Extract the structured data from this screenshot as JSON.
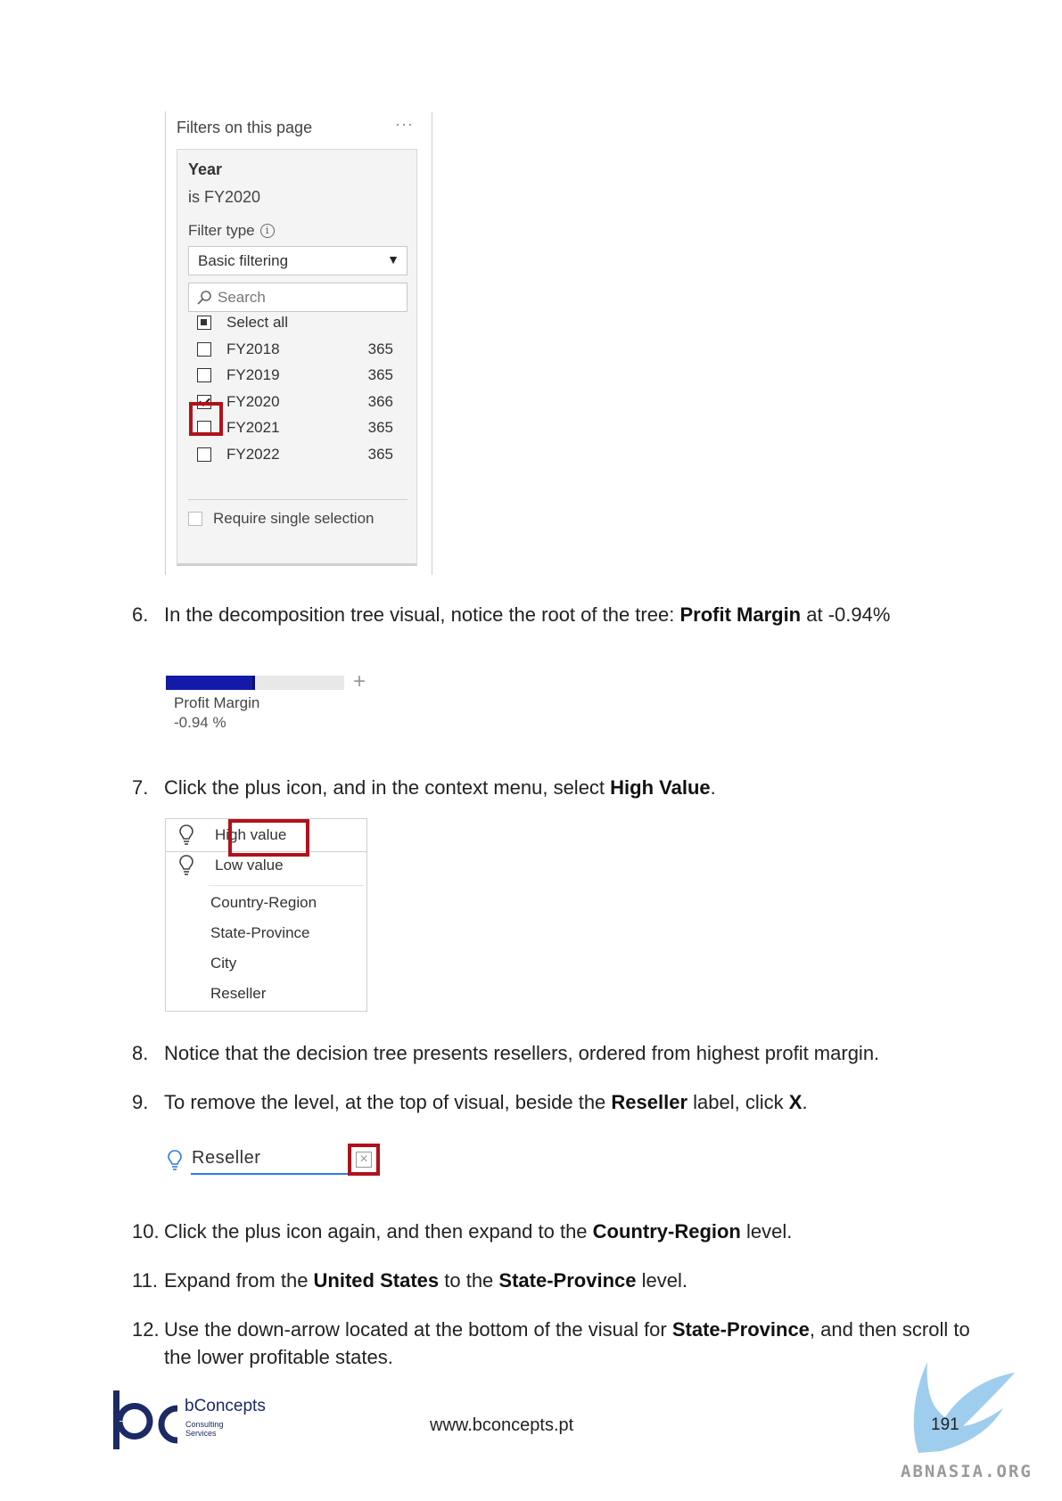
{
  "filter_pane": {
    "header": "Filters on this page",
    "more": "···",
    "card_title": "Year",
    "card_subtitle": "is FY2020",
    "filter_type_label": "Filter type",
    "info_symbol": "i",
    "dropdown_value": "Basic filtering",
    "search_placeholder": "Search",
    "select_all": "Select all",
    "items": [
      {
        "label": "FY2018",
        "count": "365",
        "checked": false
      },
      {
        "label": "FY2019",
        "count": "365",
        "checked": false
      },
      {
        "label": "FY2020",
        "count": "366",
        "checked": true
      },
      {
        "label": "FY2021",
        "count": "365",
        "checked": false
      },
      {
        "label": "FY2022",
        "count": "365",
        "checked": false
      }
    ],
    "require_single": "Require single selection",
    "highlight_color": "#b0121b"
  },
  "steps": [
    {
      "num": "6.",
      "parts": [
        {
          "t": "In the decomposition tree visual, notice the root of the tree: "
        },
        {
          "b": "Profit Margin"
        },
        {
          "t": " at -0.94%"
        }
      ]
    },
    {
      "num": "7.",
      "parts": [
        {
          "t": "Click the plus icon, and in the context menu, select "
        },
        {
          "b": "High Value"
        },
        {
          "t": "."
        }
      ]
    },
    {
      "num": "8.",
      "parts": [
        {
          "t": "Notice that the decision tree presents resellers, ordered from highest profit margin."
        }
      ]
    },
    {
      "num": "9.",
      "parts": [
        {
          "t": "To remove the level, at the top of visual, beside the "
        },
        {
          "b": "Reseller"
        },
        {
          "t": " label, click "
        },
        {
          "b": "X"
        },
        {
          "t": "."
        }
      ]
    },
    {
      "num": "10.",
      "parts": [
        {
          "t": "Click the plus icon again, and then expand to the "
        },
        {
          "b": "Country-Region"
        },
        {
          "t": " level."
        }
      ]
    },
    {
      "num": "11.",
      "parts": [
        {
          "t": "Expand from the "
        },
        {
          "b": "United States"
        },
        {
          "t": " to the "
        },
        {
          "b": "State-Province"
        },
        {
          "t": " level."
        }
      ]
    },
    {
      "num": "12.",
      "parts": [
        {
          "t": "Use the down-arrow located at the bottom of the visual for "
        },
        {
          "b": "State-Province"
        },
        {
          "t": ", and then scroll to the lower profitable states."
        }
      ]
    }
  ],
  "decomp_bar": {
    "name": "Profit Margin",
    "value": "-0.94 %",
    "fill_fraction": 0.5,
    "fill_color": "#141aa8",
    "plus": "+"
  },
  "context_menu": {
    "ai_items": [
      "High value",
      "Low value"
    ],
    "fields": [
      "Country-Region",
      "State-Province",
      "City",
      "Reseller"
    ]
  },
  "reseller": {
    "label": "Reseller",
    "x_symbol": "×",
    "underline_color": "#2b7be5"
  },
  "footer": {
    "brand": "bConcepts",
    "brand_sub1": "Consulting",
    "brand_sub2": "Services",
    "website": "www.bconcepts.pt",
    "page_number": "191",
    "watermark": "ABNASIA.ORG",
    "brand_color": "#1c2a66"
  }
}
